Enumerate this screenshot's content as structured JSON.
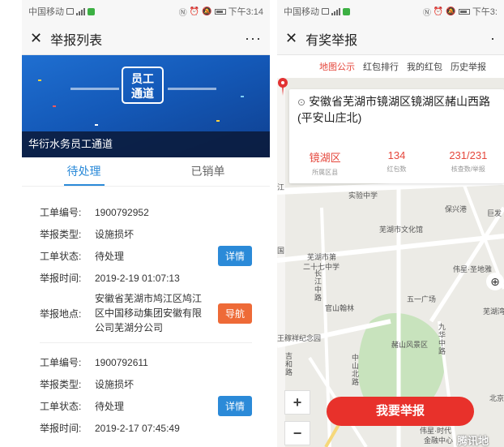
{
  "left_screen": {
    "status_bar": {
      "carrier": "中国移动",
      "time": "下午3:14"
    },
    "title": "举报列表",
    "more_label": "···",
    "banner": {
      "logo_line1": "员工",
      "logo_line2": "通道",
      "caption": "华衍水务员工通道"
    },
    "tabs": [
      {
        "label": "待处理"
      },
      {
        "label": "已销单"
      }
    ],
    "labels": {
      "order_no": "工单编号:",
      "type": "举报类型:",
      "status": "工单状态:",
      "time": "举报时间:",
      "location": "举报地点:"
    },
    "orders": [
      {
        "order_no": "1900792952",
        "type": "设施损坏",
        "status": "待处理",
        "time": "2019-2-19 01:07:13",
        "location": "安徽省芜湖市鸠江区鸠江区中国移动集团安徽有限公司芜湖分公司",
        "detail_button": "详情",
        "nav_button": "导航"
      },
      {
        "order_no": "1900792611",
        "type": "设施损坏",
        "status": "待处理",
        "time": "2019-2-17 07:45:49",
        "detail_button": "详情"
      }
    ],
    "colors": {
      "accent_blue": "#2b8ad8",
      "nav_orange": "#ee6a37"
    }
  },
  "right_screen": {
    "status_bar": {
      "carrier": "中国移动",
      "time": "下午3:"
    },
    "title": "有奖举报",
    "more_label": "·",
    "subtabs": [
      {
        "label": "地图公示",
        "active": true
      },
      {
        "label": "红包排行"
      },
      {
        "label": "我的红包"
      },
      {
        "label": "历史举报"
      }
    ],
    "info": {
      "address": "安徽省芜湖市镜湖区镜湖区赭山西路(平安山庄北)",
      "stats": [
        {
          "value": "镜湖区",
          "label": "所属区县"
        },
        {
          "value": "134",
          "label": "红包数"
        },
        {
          "value": "231/231",
          "label": "核查数/举报"
        }
      ]
    },
    "map_labels": {
      "school": "实验中学",
      "baoxinggang": "保兴港",
      "juba": "巨发",
      "culture": "芜湖市文化馆",
      "school27a": "芜湖市第",
      "school27b": "二十七中学",
      "weixing": "伟星·圣地雅",
      "guanshan": "官山翰林",
      "wuyi": "五一广场",
      "wuhuwan": "芜湖湾",
      "wangjiaxiang": "王稼祥纪念园",
      "zheshan": "赭山风景区",
      "changjiang": "长江中路",
      "jiuhua": "九华中路",
      "zhongshan": "中山北路",
      "jili": "吉和路",
      "jiangnan": "北京",
      "weixing2": "伟星·时代",
      "jinrong": "金融中心",
      "tencent": "腾讯地",
      "jiang_edge": "江",
      "guo_edge": "国"
    },
    "zoom_in": "+",
    "zoom_out": "−",
    "report_button": "我要举报",
    "colors": {
      "accent_red": "#e5473c",
      "button_red": "#e8312b"
    }
  }
}
